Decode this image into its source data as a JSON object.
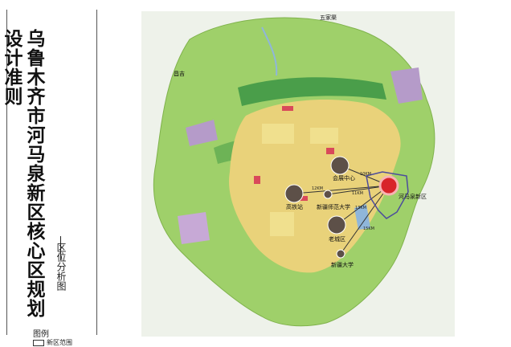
{
  "title": "乌鲁木齐市河马泉新区核心区规划设计准则",
  "subtitle": "区位分析图",
  "legend": {
    "heading": "图例",
    "items": [
      {
        "label": "新区范围"
      }
    ]
  },
  "map": {
    "place_labels": [
      {
        "id": "wujiaqu",
        "text": "五家渠"
      },
      {
        "id": "changji",
        "text": "昌吉"
      },
      {
        "id": "gaotie",
        "text": "高铁站"
      },
      {
        "id": "huizhan",
        "text": "会展中心"
      },
      {
        "id": "shida",
        "text": "新疆师范大学"
      },
      {
        "id": "laocheng",
        "text": "老城区"
      },
      {
        "id": "xinda",
        "text": "新疆大学"
      },
      {
        "id": "hemaquan",
        "text": "河马泉新区"
      }
    ],
    "distance_labels": [
      {
        "id": "d1",
        "text": "12KM"
      },
      {
        "id": "d2",
        "text": "10KM"
      },
      {
        "id": "d3",
        "text": "11KM"
      },
      {
        "id": "d4",
        "text": "13KM"
      },
      {
        "id": "d5",
        "text": "15KM"
      }
    ],
    "colors": {
      "green_space": "#9fd06a",
      "urban": "#e9d27a",
      "residential": "#f0e08e",
      "commercial": "#d9495a",
      "industrial": "#b59bc9",
      "water": "#8fb6da",
      "new_district_circle": "#d8242a",
      "node_circle": "#5d5048",
      "boundary": "#4c4c9c"
    }
  }
}
